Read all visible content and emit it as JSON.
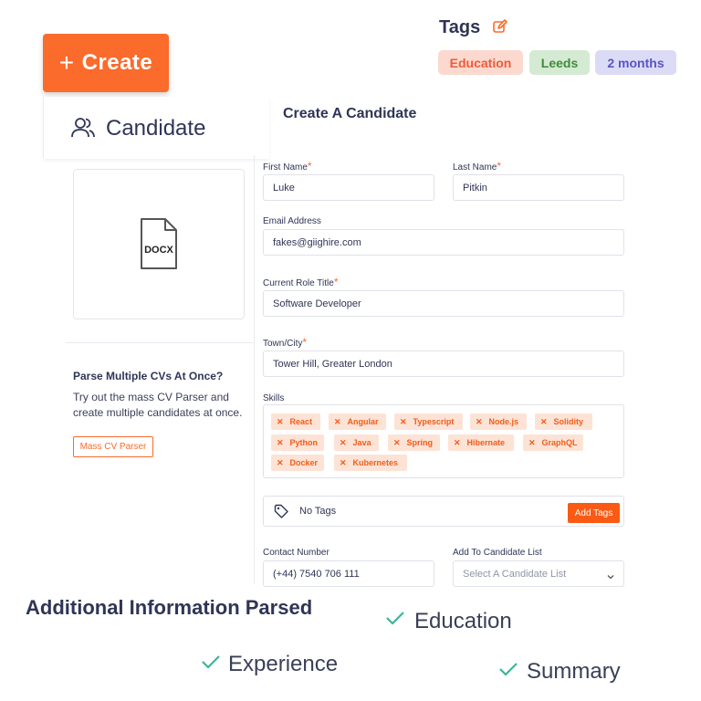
{
  "create_button": {
    "label": "Create",
    "plus": "+"
  },
  "tags": {
    "title": "Tags",
    "items": [
      {
        "label": "Education",
        "bg": "#fcd9cf",
        "fg": "#f05a3a"
      },
      {
        "label": "Leeds",
        "bg": "#d5ead2",
        "fg": "#3f8a3b"
      },
      {
        "label": "2 months",
        "bg": "#dcdbf5",
        "fg": "#5a55c8"
      }
    ]
  },
  "candidate": {
    "label": "Candidate"
  },
  "form": {
    "title": "Create A Candidate",
    "first_name": {
      "label": "First Name",
      "value": "Luke"
    },
    "last_name": {
      "label": "Last Name",
      "value": "Pitkin"
    },
    "email": {
      "label": "Email Address",
      "value": "fakes@giighire.com"
    },
    "role": {
      "label": "Current Role Title",
      "value": "Software Developer"
    },
    "town": {
      "label": "Town/City",
      "value": "Tower Hill, Greater London"
    },
    "skills": {
      "label": "Skills",
      "items": [
        "React",
        "Angular",
        "Typescript",
        "Node.js",
        "Solidity",
        "Python",
        "Java",
        "Spring",
        "Hibernate",
        "GraphQL",
        "Docker",
        "Kubernetes"
      ]
    },
    "no_tags": "No Tags",
    "add_tags": "Add Tags",
    "contact": {
      "label": "Contact Number",
      "value": "(+44) 7540 706 111"
    },
    "candidate_list": {
      "label": "Add To Candidate List",
      "placeholder": "Select A Candidate List"
    },
    "required_mark": "*"
  },
  "left_panel": {
    "docx_label": "DOCX",
    "parse_title": "Parse Multiple CVs At Once?",
    "parse_desc": "Try out the mass CV Parser and create multiple candidates at once.",
    "mass_button": "Mass CV Parser"
  },
  "additional": {
    "title": "Additional Information Parsed",
    "items": [
      "Education",
      "Experience",
      "Summary"
    ]
  },
  "colors": {
    "accent": "#fa6b2c",
    "check": "#3bb59a",
    "text": "#2f3556"
  }
}
